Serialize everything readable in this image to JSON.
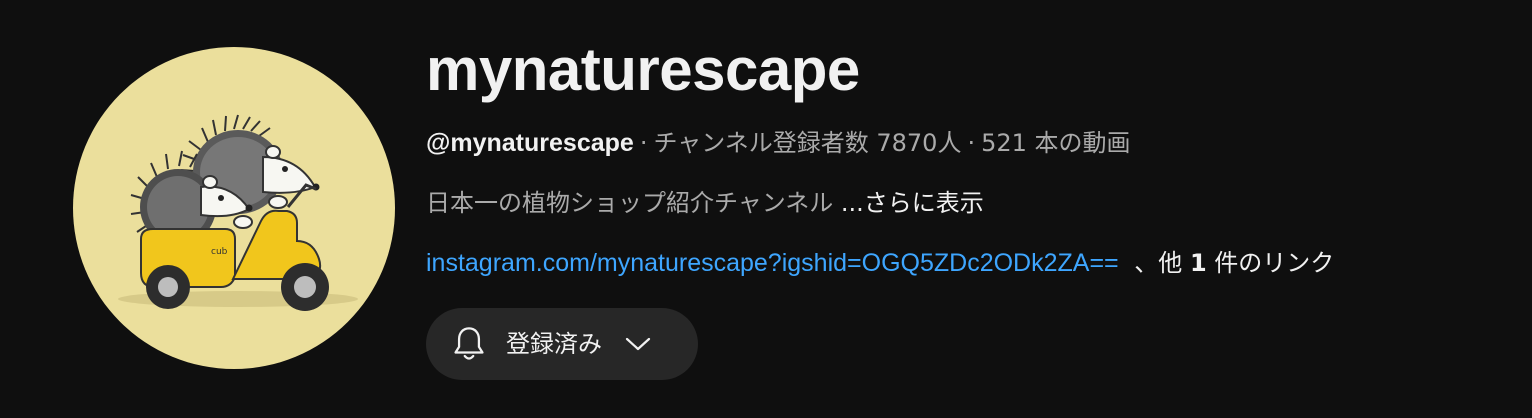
{
  "channel": {
    "name": "mynaturescape",
    "handle": "@mynaturescape",
    "separator": "·",
    "subscribers_text": "チャンネル登録者数 7870人",
    "videos_text": "521 本の動画",
    "description": "日本一の植物ショップ紹介チャンネル",
    "description_more": "...さらに表示"
  },
  "links": {
    "primary_url": "instagram.com/mynaturescape?igshid=OGQ5ZDc2ODk2ZA==",
    "others_prefix": "、他",
    "others_count": "1",
    "others_suffix": "件のリンク"
  },
  "subscribe_button": {
    "label": "登録済み",
    "icon": "bell-icon",
    "dropdown_icon": "chevron-down-icon"
  },
  "avatar": {
    "logo_text": "cub",
    "colors": {
      "background": "#ebdf9c",
      "scooter": "#f1c61c"
    }
  },
  "colors": {
    "page_background": "#0f0f0f",
    "text_primary": "#f1f1f1",
    "text_secondary": "#aaaaaa",
    "link": "#3ea6ff",
    "button_background": "#272727"
  }
}
